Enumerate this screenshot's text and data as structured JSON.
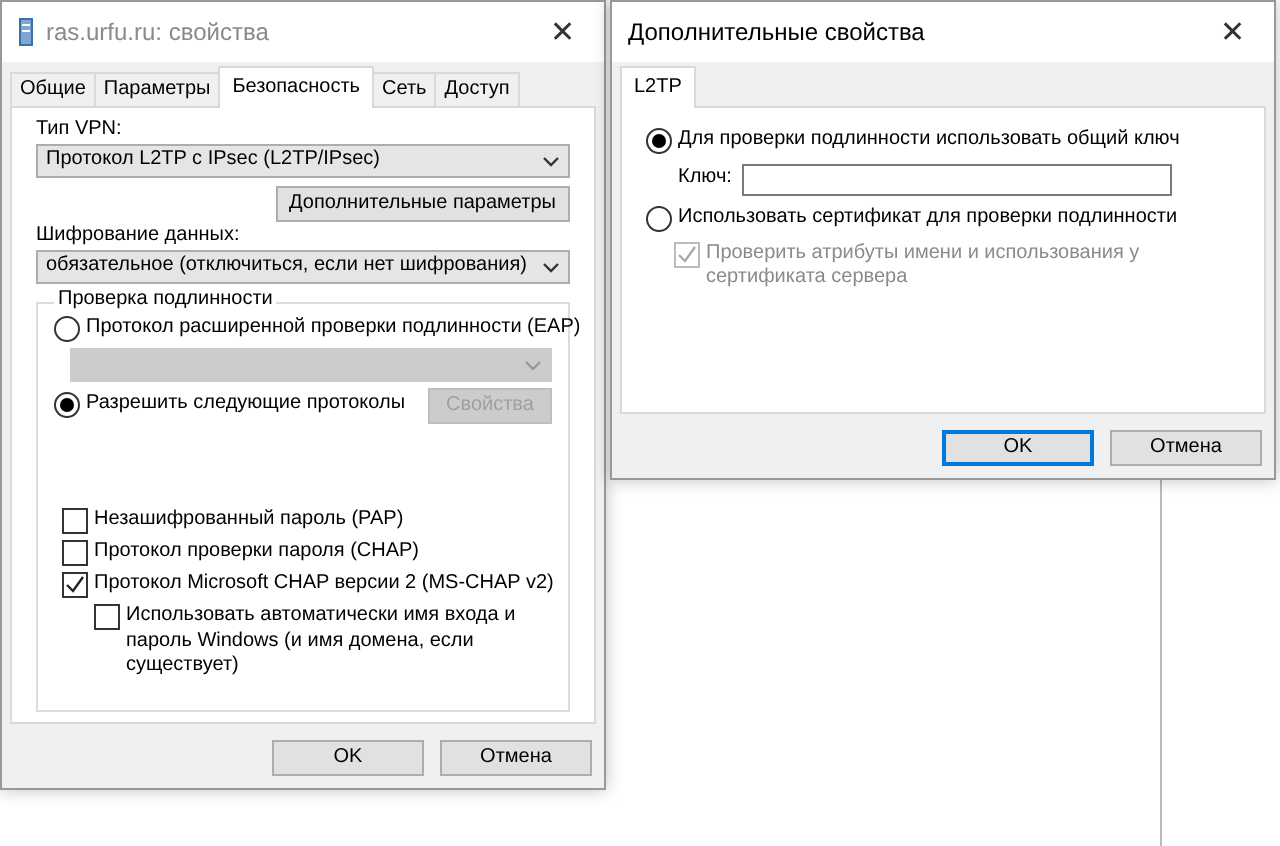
{
  "properties_dialog": {
    "title": "ras.urfu.ru: свойства",
    "close": "✕",
    "tabs": [
      {
        "label": "Общие",
        "selected": false
      },
      {
        "label": "Параметры",
        "selected": false
      },
      {
        "label": "Безопасность",
        "selected": true
      },
      {
        "label": "Сеть",
        "selected": false
      },
      {
        "label": "Доступ",
        "selected": false
      }
    ],
    "vpn_type": {
      "label": "Тип VPN:",
      "value": "Протокол L2TP с IPsec (L2TP/IPsec)"
    },
    "advanced_button": "Дополнительные параметры",
    "encryption": {
      "label": "Шифрование данных:",
      "value": "обязательное (отключиться, если нет шифрования)"
    },
    "auth": {
      "title": "Проверка подлинности",
      "options": [
        {
          "kind": "eap",
          "label": "Протокол расширенной проверки подлинности (EAP)",
          "selected": false,
          "disabled": true
        },
        {
          "kind": "allow",
          "label": "Разрешить следующие протоколы",
          "selected": true,
          "button": "Свойства",
          "disabled": true
        }
      ],
      "protocols": [
        {
          "label": "Незашифрованный пароль (PAP)",
          "checked": false
        },
        {
          "label": "Протокол проверки пароля (CHAP)",
          "checked": false
        },
        {
          "label": "Протокол Microsoft CHAP версии 2 (MS-CHAP v2)",
          "checked": true,
          "children": [
            {
              "label": "Использовать автоматически имя входа и пароль Windows (и имя домена, если существует)",
              "checked": false
            }
          ]
        }
      ]
    },
    "buttons": [
      {
        "label": "OK"
      },
      {
        "label": "Отмена"
      }
    ]
  },
  "advanced_dialog": {
    "title": "Дополнительные свойства",
    "close": "✕",
    "tabs": [
      {
        "label": "L2TP",
        "selected": true
      }
    ],
    "options": [
      {
        "kind": "key",
        "label": "Для проверки подлинности использовать общий ключ",
        "selected": true,
        "field_label": "Ключ:"
      },
      {
        "kind": "cert",
        "label": "Использовать сертификат для проверки подлинности",
        "selected": false,
        "check": {
          "label": "Проверить атрибуты имени и использования у сертификата сервера",
          "checked": true,
          "disabled": true
        }
      }
    ],
    "buttons": [
      {
        "label": "OK",
        "default": true
      },
      {
        "label": "Отмена",
        "default": false
      }
    ]
  }
}
